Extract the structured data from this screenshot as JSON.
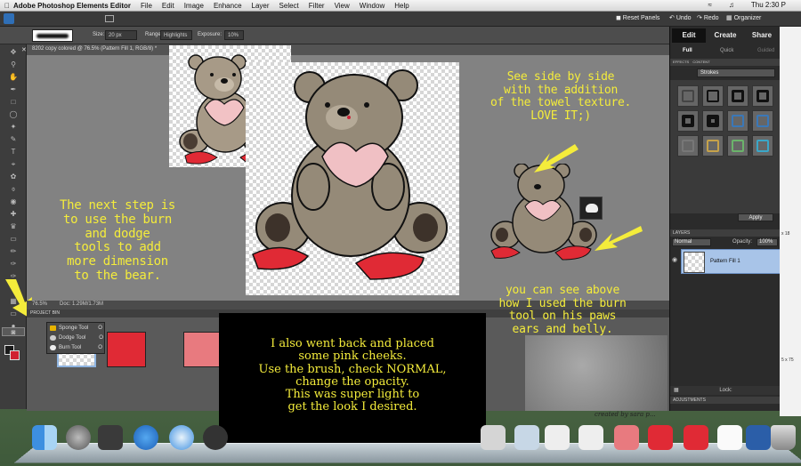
{
  "menubar": {
    "app_name": "Adobe Photoshop Elements Editor",
    "items": [
      "File",
      "Edit",
      "Image",
      "Enhance",
      "Layer",
      "Select",
      "Filter",
      "View",
      "Window",
      "Help"
    ],
    "clock": "Thu 2:30 P"
  },
  "toolbar_top": {
    "reset_panels": "Reset Panels",
    "undo": "Undo",
    "redo": "Redo",
    "organizer": "Organizer"
  },
  "tool_options": {
    "size_label": "Size:",
    "size_value": "20 px",
    "range_label": "Range",
    "range_value": "Highlights",
    "exposure_label": "Exposure:",
    "exposure_value": "10%"
  },
  "document": {
    "tab_title": "8202 copy colored @ 76.5% (Pattern Fill 1, RGB/8) *",
    "zoom": "76.5%",
    "doc_size": "Doc: 1.29M/1.73M"
  },
  "project_bin": {
    "title": "PROJECT BIN"
  },
  "tool_flyout": [
    {
      "label": "Sponge Tool",
      "shortcut": "O"
    },
    {
      "label": "Dodge Tool",
      "shortcut": "O"
    },
    {
      "label": "Burn Tool",
      "shortcut": "O"
    }
  ],
  "right_panel": {
    "tabs": [
      "Edit",
      "Create",
      "Share"
    ],
    "modes": [
      "Full",
      "Quick",
      "Guided"
    ],
    "effects_tabs": [
      "EFFECTS",
      "CONTENT"
    ],
    "effects_dropdown": "Strokes",
    "apply": "Apply",
    "layers_title": "LAYERS",
    "blend_mode": "Normal",
    "opacity_label": "Opacity:",
    "opacity_value": "100%",
    "layer_name": "Pattern Fill 1",
    "lock_label": "Lock:",
    "adjustments_title": "ADJUSTMENTS"
  },
  "annotations": {
    "side_by_side": [
      "See side by side",
      "with the addition",
      "of the towel texture.",
      "LOVE IT;)"
    ],
    "next_step": [
      "The next step is",
      "to use the burn",
      "and dodge",
      "tools to add",
      "more dimension",
      "to the bear."
    ],
    "burn_paws": [
      "you can see above",
      "how I used the burn",
      "tool on his paws",
      "ears and belly."
    ],
    "callout": [
      "I also went back and placed",
      "some pink cheeks.",
      "Use the brush, check NORMAL,",
      "change the opacity.",
      "This was super light to",
      "get the look I desired."
    ]
  },
  "desktop_right": {
    "fragments": [
      "5 x 75",
      "x 18"
    ]
  },
  "watermark": "created by sara p...",
  "colors": {
    "annotation_yellow": "#f4ec3b",
    "pattern_red": "#e02a35",
    "bear_fur": "#a89a88"
  },
  "icons": [
    "finder-icon",
    "launchpad-icon",
    "app-store-icon",
    "safari-icon",
    "camera-icon",
    "trash-icon"
  ]
}
